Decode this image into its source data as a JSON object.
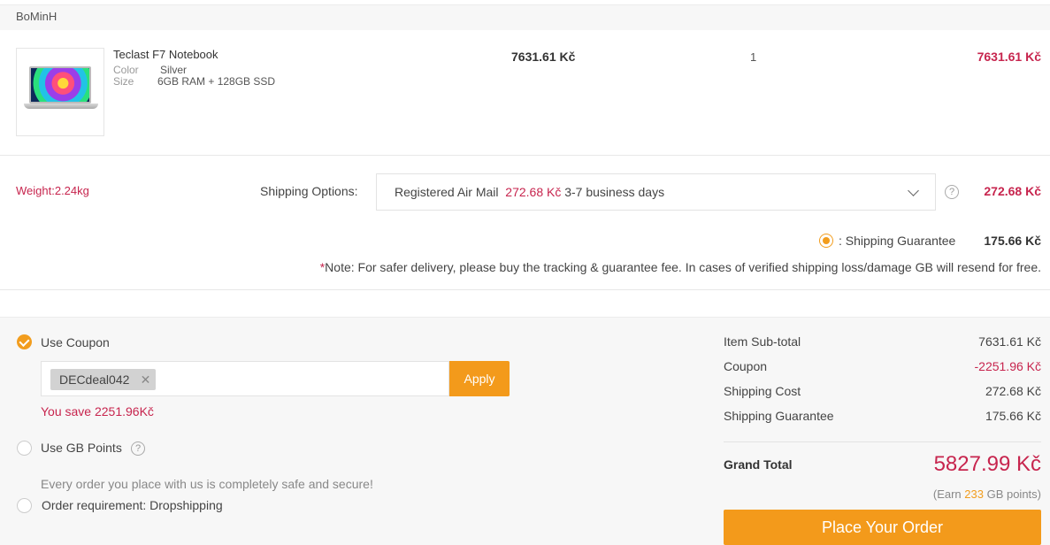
{
  "seller": {
    "name": "BoMinH"
  },
  "product": {
    "title": "Teclast F7 Notebook",
    "color_label": "Color",
    "color_value": "Silver",
    "size_label": "Size",
    "size_value": "6GB RAM + 128GB SSD",
    "price": "7631.61 Kč",
    "quantity": "1",
    "line_total": "7631.61 Kč"
  },
  "shipping": {
    "weight": "Weight:2.24kg",
    "options_label": "Shipping Options:",
    "method": "Registered Air Mail",
    "method_price": "272.68 Kč",
    "method_time": "3-7 business days",
    "help_icon": "?",
    "total": "272.68 Kč",
    "guarantee_label": ": Shipping Guarantee",
    "guarantee_amount": "175.66 Kč",
    "note_star": "*",
    "note": "Note: For safer delivery, please buy the tracking & guarantee fee. In cases of verified shipping loss/damage GB will resend for free."
  },
  "coupon": {
    "use_label": "Use Coupon",
    "code": "DECdeal042",
    "remove_icon": "✕",
    "apply_label": "Apply",
    "save_text": "You save 2251.96Kč"
  },
  "points": {
    "use_label": "Use GB Points",
    "help_icon": "?"
  },
  "secure_text": "Every order you place with us is completely safe and secure!",
  "dropshipping_label": "Order requirement: Dropshipping",
  "summary": {
    "subtotal_label": "Item Sub-total",
    "subtotal": "7631.61 Kč",
    "coupon_label": "Coupon",
    "coupon": "-2251.96 Kč",
    "shipping_label": "Shipping Cost",
    "shipping": "272.68 Kč",
    "guarantee_label": "Shipping Guarantee",
    "guarantee": "175.66 Kč",
    "grand_total_label": "Grand Total",
    "grand_total": "5827.99 Kč",
    "earn_prefix": "(Earn ",
    "earn_points": "233",
    "earn_suffix": " GB points)",
    "place_order_label": "Place Your Order"
  },
  "colors": {
    "accent_orange": "#f39a1b",
    "price_red": "#c7254e"
  },
  "icons": [
    "laptop-thumbnail",
    "chevron-down-icon",
    "help-icon",
    "checkmark-icon",
    "close-icon"
  ]
}
